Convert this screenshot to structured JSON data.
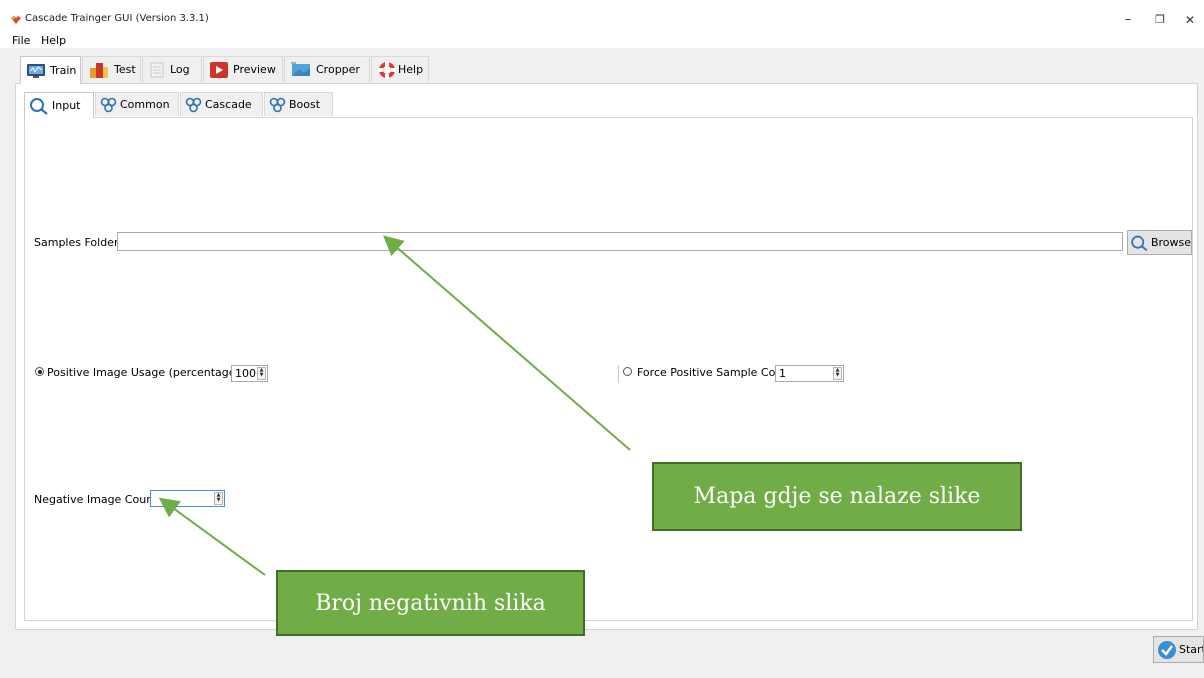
{
  "window": {
    "title": "Cascade Trainger GUI (Version 3.3.1)",
    "minimize_glyph": "–",
    "maximize_glyph": "❐",
    "close_glyph": "✕"
  },
  "menu": {
    "items": [
      {
        "label": "File"
      },
      {
        "label": "Help"
      }
    ]
  },
  "main_tabs": [
    {
      "label": "Train",
      "icon": "monitor-icon",
      "active": true
    },
    {
      "label": "Test",
      "icon": "blocks-icon"
    },
    {
      "label": "Log",
      "icon": "document-icon"
    },
    {
      "label": "Preview",
      "icon": "play-icon"
    },
    {
      "label": "Cropper",
      "icon": "crop-image-icon"
    },
    {
      "label": "Help",
      "icon": "lifebuoy-icon"
    }
  ],
  "sub_tabs": [
    {
      "label": "Input",
      "icon": "search-icon",
      "active": true
    },
    {
      "label": "Common",
      "icon": "gears-icon"
    },
    {
      "label": "Cascade",
      "icon": "gears-icon"
    },
    {
      "label": "Boost",
      "icon": "gears-icon"
    }
  ],
  "input": {
    "samples_folder_label": "Samples Folder :",
    "samples_folder_value": "",
    "browse_label": "Browse",
    "positive_usage_label": "Positive Image Usage (percentage) :",
    "positive_usage_value": "100",
    "positive_usage_selected": true,
    "force_positive_label": "Force Positive Sample Count :",
    "force_positive_value": "1",
    "force_positive_selected": false,
    "negative_count_label": "Negative Image Count :",
    "negative_count_value": ""
  },
  "start_label": "Start",
  "annotations": {
    "folder_callout": "Mapa gdje se nalaze slike",
    "negative_callout": "Broj negativnih slika",
    "callout_color": "#70ad47",
    "arrow_color": "#70ad47"
  }
}
